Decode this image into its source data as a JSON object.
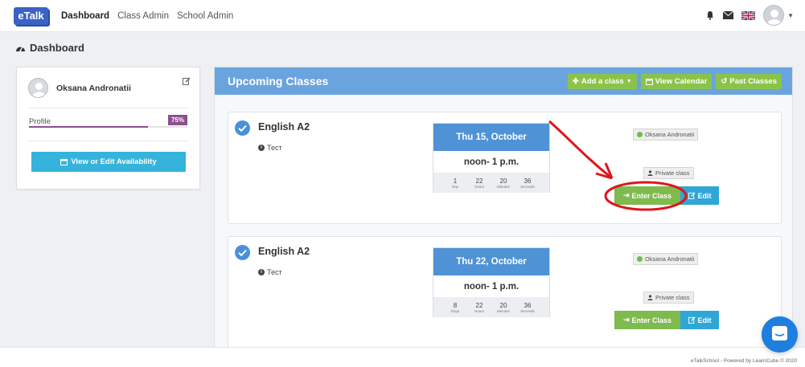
{
  "nav": {
    "logo": "eTalk",
    "links": [
      "Dashboard",
      "Class Admin",
      "School Admin"
    ]
  },
  "page": {
    "title": "Dashboard"
  },
  "profile": {
    "name": "Oksana Andronatii",
    "label": "Profile",
    "progress_text": "75%",
    "progress": 0.75,
    "availability_button": "View or Edit Availability"
  },
  "upcoming": {
    "title": "Upcoming Classes",
    "add_class": "Add a class",
    "view_calendar": "View Calendar",
    "past_classes": "Past Classes",
    "classes": [
      {
        "name": "English A2",
        "desc": "Тест",
        "date": "Thu 15, October",
        "time": "noon- 1 p.m.",
        "countdown": [
          {
            "num": "1",
            "lbl": "Day"
          },
          {
            "num": "22",
            "lbl": "Hours"
          },
          {
            "num": "20",
            "lbl": "Minutes"
          },
          {
            "num": "36",
            "lbl": "Seconds"
          }
        ],
        "teacher": "Oksana Andronatii",
        "type": "Private class",
        "enter": "Enter Class",
        "edit": "Edit"
      },
      {
        "name": "English A2",
        "desc": "Тест",
        "date": "Thu 22, October",
        "time": "noon- 1 p.m.",
        "countdown": [
          {
            "num": "8",
            "lbl": "Days"
          },
          {
            "num": "22",
            "lbl": "Hours"
          },
          {
            "num": "20",
            "lbl": "Minutes"
          },
          {
            "num": "36",
            "lbl": "Seconds"
          }
        ],
        "teacher": "Oksana Andronatii",
        "type": "Private class",
        "enter": "Enter Class",
        "edit": "Edit"
      }
    ]
  },
  "footer": {
    "text": "eTalkSchool - Powered by LearnCube © 2020"
  },
  "colors": {
    "brand": "#3a63c6",
    "header": "#6aa4df",
    "green": "#7fba4f",
    "blue": "#2fa7d6",
    "purple": "#8c4f8f",
    "annotation_red": "#e0141b"
  },
  "icons": [
    "dashboard-icon",
    "bell-icon",
    "mail-icon",
    "uk-flag-icon",
    "user-avatar-icon",
    "edit-icon",
    "calendar-icon",
    "plus-icon",
    "history-icon",
    "check-circle-icon",
    "info-icon",
    "sign-in-icon",
    "user-icon",
    "chat-icon"
  ]
}
